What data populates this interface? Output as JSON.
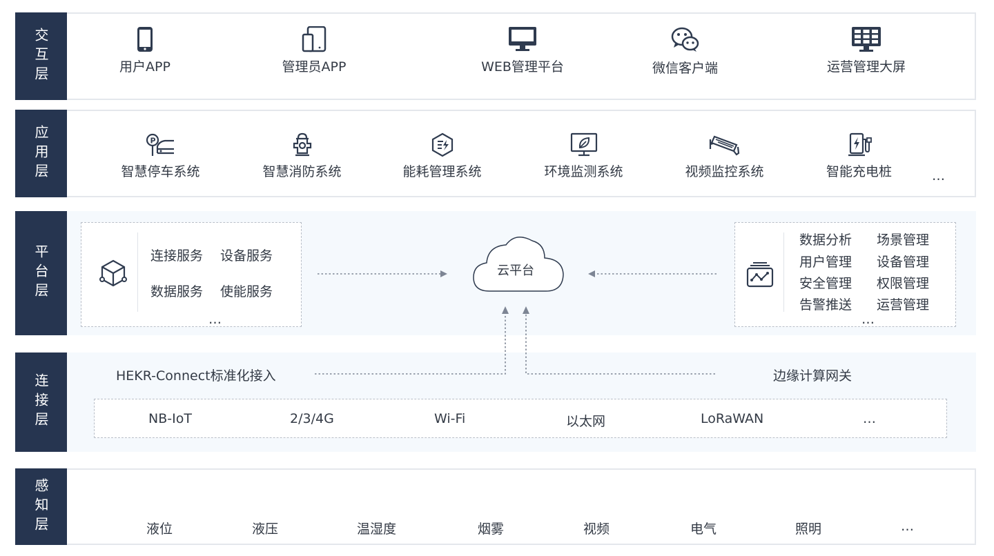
{
  "layers": {
    "interaction": {
      "label": "交互层",
      "items": [
        {
          "label": "用户APP",
          "icon": "phone-icon"
        },
        {
          "label": "管理员APP",
          "icon": "tablet-phone-icon"
        },
        {
          "label": "WEB管理平台",
          "icon": "monitor-icon"
        },
        {
          "label": "微信客户端",
          "icon": "wechat-icon"
        },
        {
          "label": "运营管理大屏",
          "icon": "big-screen-icon"
        }
      ]
    },
    "application": {
      "label": "应用层",
      "items": [
        {
          "label": "智慧停车系统",
          "icon": "parking-icon"
        },
        {
          "label": "智慧消防系统",
          "icon": "hydrant-icon"
        },
        {
          "label": "能耗管理系统",
          "icon": "energy-icon"
        },
        {
          "label": "环境监测系统",
          "icon": "leaf-monitor-icon"
        },
        {
          "label": "视频监控系统",
          "icon": "camera-icon"
        },
        {
          "label": "智能充电桩",
          "icon": "charger-icon"
        }
      ],
      "more": "…"
    },
    "platform": {
      "label": "平台层",
      "left_services": [
        "连接服务",
        "设备服务",
        "数据服务",
        "使能服务"
      ],
      "left_more": "…",
      "cloud_label": "云平台",
      "right_services": [
        "数据分析",
        "场景管理",
        "用户管理",
        "设备管理",
        "安全管理",
        "权限管理",
        "告警推送",
        "运营管理"
      ],
      "right_more": "…"
    },
    "connection": {
      "label": "连接层",
      "left_title": "HEKR-Connect标准化接入",
      "right_title": "边缘计算网关",
      "protocols": [
        "NB-IoT",
        "2/3/4G",
        "Wi-Fi",
        "以太网",
        "LoRaWAN",
        "…"
      ]
    },
    "perception": {
      "label": "感知层",
      "items": [
        "液位",
        "液压",
        "温湿度",
        "烟雾",
        "视频",
        "电气",
        "照明",
        "…"
      ]
    }
  },
  "colors": {
    "label_bg": "#263550",
    "text": "#333a45",
    "tint_bg": "#f5f9fd",
    "border": "#e4e7ec"
  }
}
